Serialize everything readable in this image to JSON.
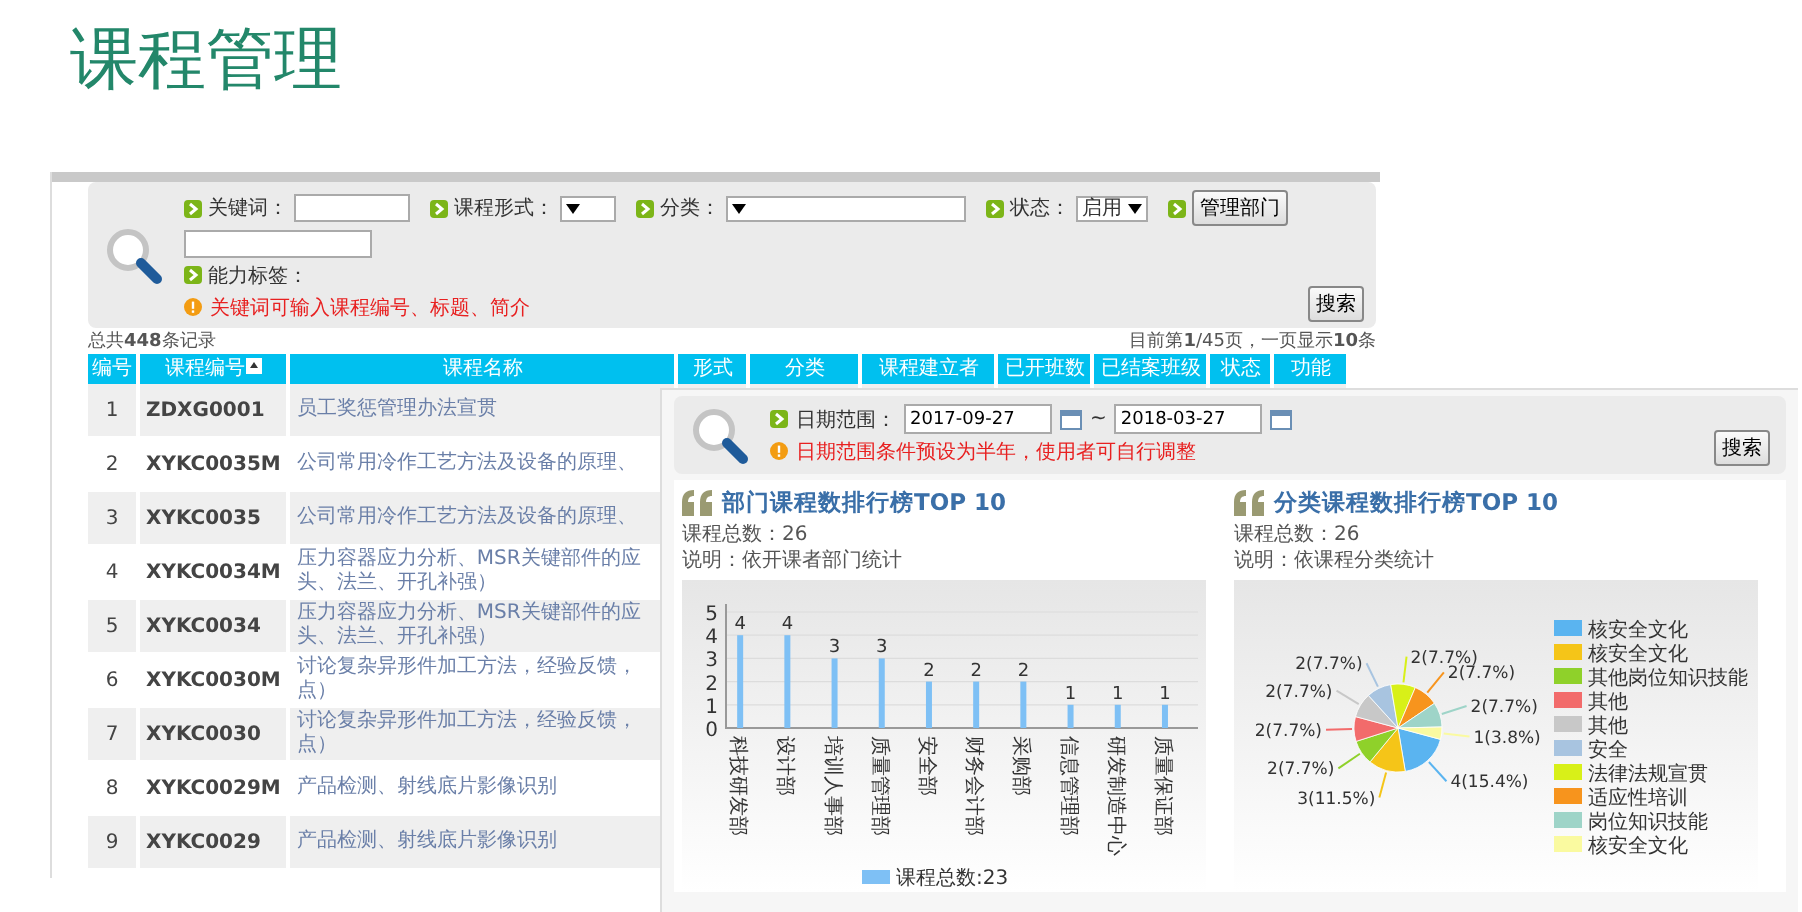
{
  "slide_title": "课程管理",
  "course_list": {
    "search": {
      "rows": [
        [
          {
            "kind": "text",
            "label": "关键词："
          },
          {
            "kind": "select",
            "label": "课程形式：",
            "wide": false
          },
          {
            "kind": "select",
            "label": "分类：",
            "wide": true
          },
          {
            "kind": "select",
            "label": "状态：",
            "value": "启用",
            "wide": false
          },
          {
            "kind": "button",
            "label": "管理部门"
          }
        ],
        [
          {
            "kind": "text"
          }
        ],
        [
          {
            "kind": "label",
            "label": "能力标签："
          }
        ]
      ],
      "hint": "关键词可输入课程编号、标题、简介",
      "button": "搜索"
    },
    "records": {
      "total": "总共**448**条记录",
      "page": "目前第**1**/45页，一页显示**10**条"
    },
    "table": {
      "columns": [
        {
          "label": "编号",
          "sortable": false
        },
        {
          "label": "课程编号",
          "sortable": true
        },
        {
          "label": "课程名称",
          "sortable": false
        },
        {
          "label": "形式",
          "sortable": false
        },
        {
          "label": "分类",
          "sortable": false
        },
        {
          "label": "课程建立者",
          "sortable": false
        },
        {
          "label": "已开班数",
          "sortable": false
        },
        {
          "label": "已结案班级",
          "sortable": false
        },
        {
          "label": "状态",
          "sortable": false
        },
        {
          "label": "功能",
          "sortable": false
        }
      ],
      "rows": [
        {
          "no": "1",
          "code": "ZDXG0001",
          "name": [
            "员工奖惩管理办法宣贯"
          ]
        },
        {
          "no": "2",
          "code": "XYKC0035M",
          "name": [
            "公司常用冷作工艺方法及设备的原理、"
          ]
        },
        {
          "no": "3",
          "code": "XYKC0035",
          "name": [
            "公司常用冷作工艺方法及设备的原理、"
          ]
        },
        {
          "no": "4",
          "code": "XYKC0034M",
          "name": [
            "压力容器应力分析、MSR关键部件的应",
            "头、法兰、开孔补强）"
          ]
        },
        {
          "no": "5",
          "code": "XYKC0034",
          "name": [
            "压力容器应力分析、MSR关键部件的应",
            "头、法兰、开孔补强）"
          ]
        },
        {
          "no": "6",
          "code": "XYKC0030M",
          "name": [
            "讨论复杂异形件加工方法，经验反馈，",
            "点）"
          ]
        },
        {
          "no": "7",
          "code": "XYKC0030",
          "name": [
            "讨论复杂异形件加工方法，经验反馈，",
            "点）"
          ]
        },
        {
          "no": "8",
          "code": "XYKC0029M",
          "name": [
            "产品检测、射线底片影像识别"
          ]
        },
        {
          "no": "9",
          "code": "XYKC0029",
          "name": [
            "产品检测、射线底片影像识别"
          ]
        }
      ]
    }
  },
  "stats_window": {
    "search": {
      "label": "日期范围：",
      "date_from": "2017-09-27",
      "separator": "~",
      "date_to": "2018-03-27",
      "hint": "日期范围条件预设为半年，使用者可自行调整",
      "button": "搜索"
    },
    "charts": [
      {
        "total": "课程总数：26",
        "note": "说明：依开课者部门统计",
        "chart_data": {
          "type": "bar",
          "title": "部门课程数排行榜TOP 10",
          "categories": [
            "科技研发部",
            "设计部",
            "培训人事部",
            "质量管理部",
            "安全部",
            "财务会计部",
            "采购部",
            "信息管理部",
            "研发制造中心",
            "质量保证部"
          ],
          "series": [
            {
              "name": "课程总数:23",
              "color": "#7ec0f5",
              "values": [
                4,
                4,
                3,
                3,
                2,
                2,
                2,
                1,
                1,
                1
              ]
            }
          ],
          "ylim": [
            0,
            5
          ],
          "yticks": [
            {
              "value": 0,
              "label": "0"
            },
            {
              "value": 1,
              "label": "1"
            },
            {
              "value": 2,
              "label": "2"
            },
            {
              "value": 3,
              "label": "3"
            },
            {
              "value": 4,
              "label": "4"
            },
            {
              "value": 5,
              "label": "5"
            }
          ],
          "grid": true,
          "legend": true,
          "data_labels": true
        }
      },
      {
        "total": "课程总数：26",
        "note": "说明：依课程分类统计",
        "chart_data": {
          "type": "pie",
          "title": "分类课程数排行榜TOP 10",
          "categories": [
            "核安全文化",
            "核安全文化",
            "其他岗位知识技能",
            "其他",
            "其他",
            "安全",
            "法律法规宣贯",
            "适应性培训",
            "岗位知识技能",
            "核安全文化"
          ],
          "values": [
            4,
            3,
            2,
            2,
            2,
            2,
            2,
            2,
            2,
            1
          ],
          "colors": [
            "#5ab4f0",
            "#f5c518",
            "#8fd12a",
            "#f26b6b",
            "#c8c8c8",
            "#a8c4e0",
            "#d8f018",
            "#f7941d",
            "#9ed4c8",
            "#fafaa0"
          ],
          "legend": true,
          "value_labels": [
            "4(15.4%)",
            "3(11.5%)",
            "2(7.7%)",
            "2(7.7%)",
            "2(7.7%)",
            "2(7.7%)",
            "2(7.7%)",
            "2(7.7%)",
            "2(7.7%)",
            "1(3.8%)"
          ]
        }
      }
    ]
  }
}
